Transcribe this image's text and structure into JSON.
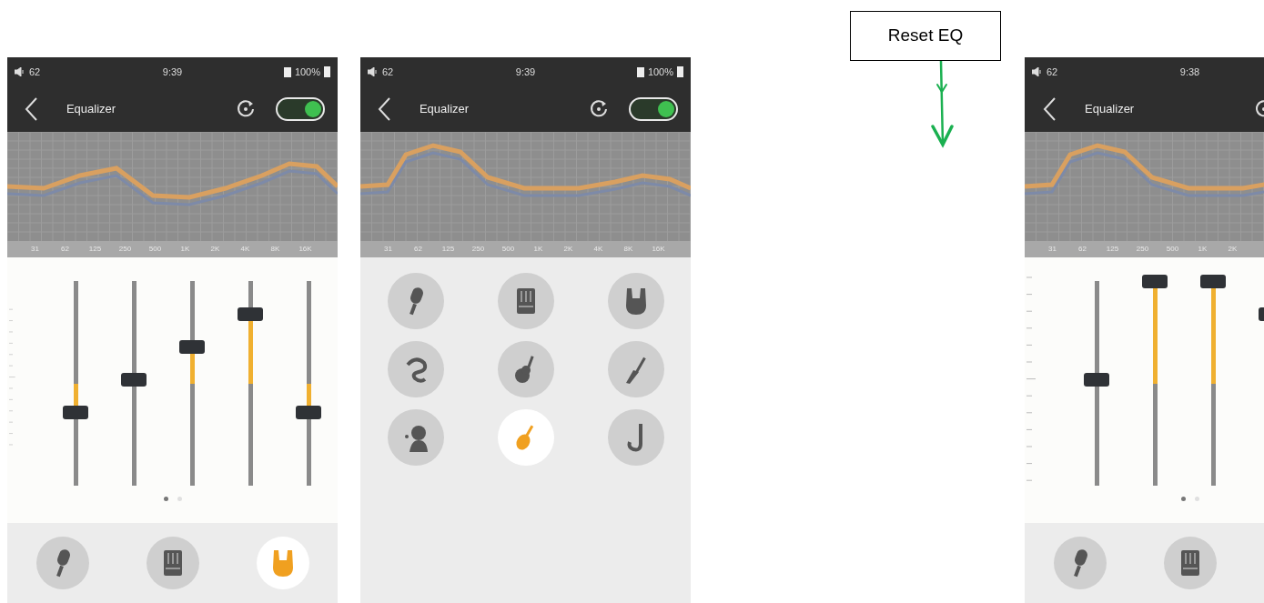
{
  "screens": [
    {
      "status": {
        "volume": "62",
        "time": "9:39",
        "battery": "100%"
      },
      "title": "Equalizer",
      "enabled": true,
      "frequencies": [
        "31",
        "62",
        "125",
        "250",
        "500",
        "1K",
        "2K",
        "4K",
        "8K",
        "16K"
      ],
      "kind": "sliders",
      "bands": [
        {
          "level": 0.36
        },
        {
          "level": 0.52
        },
        {
          "level": 0.68
        },
        {
          "level": 0.84
        },
        {
          "level": 0.36
        }
      ],
      "pages": [
        {
          "selected": true
        },
        {
          "selected": false
        }
      ],
      "presets": [
        {
          "kind": "mic",
          "selected": false
        },
        {
          "kind": "mixer",
          "selected": false
        },
        {
          "kind": "rock",
          "selected": true
        }
      ]
    },
    {
      "status": {
        "volume": "62",
        "time": "9:39",
        "battery": "100%"
      },
      "title": "Equalizer",
      "enabled": true,
      "frequencies": [
        "31",
        "62",
        "125",
        "250",
        "500",
        "1K",
        "2K",
        "4K",
        "8K",
        "16K"
      ],
      "kind": "presets",
      "presets": [
        {
          "kind": "mic",
          "selected": false
        },
        {
          "kind": "mixer",
          "selected": false
        },
        {
          "kind": "rock",
          "selected": false
        },
        {
          "kind": "swirl",
          "selected": false
        },
        {
          "kind": "acoustic",
          "selected": false
        },
        {
          "kind": "electric",
          "selected": false
        },
        {
          "kind": "singer",
          "selected": false
        },
        {
          "kind": "violin",
          "selected": true
        },
        {
          "kind": "sax",
          "selected": false
        }
      ]
    },
    {
      "status": {
        "volume": "62",
        "time": "9:38"
      },
      "title": "Equalizer",
      "frequencies": [
        "31",
        "62",
        "125",
        "250",
        "500",
        "1K",
        "2K"
      ],
      "kind": "sliders",
      "bands": [
        {
          "level": 0.52
        },
        {
          "level": 1.0
        },
        {
          "level": 1.0
        },
        {
          "level": 0.84
        }
      ],
      "pages": [
        {
          "selected": true
        },
        {
          "selected": false
        }
      ],
      "presets": [
        {
          "kind": "mic",
          "selected": false
        },
        {
          "kind": "mixer",
          "selected": false
        }
      ]
    }
  ],
  "annotation": {
    "label": "Reset EQ"
  }
}
